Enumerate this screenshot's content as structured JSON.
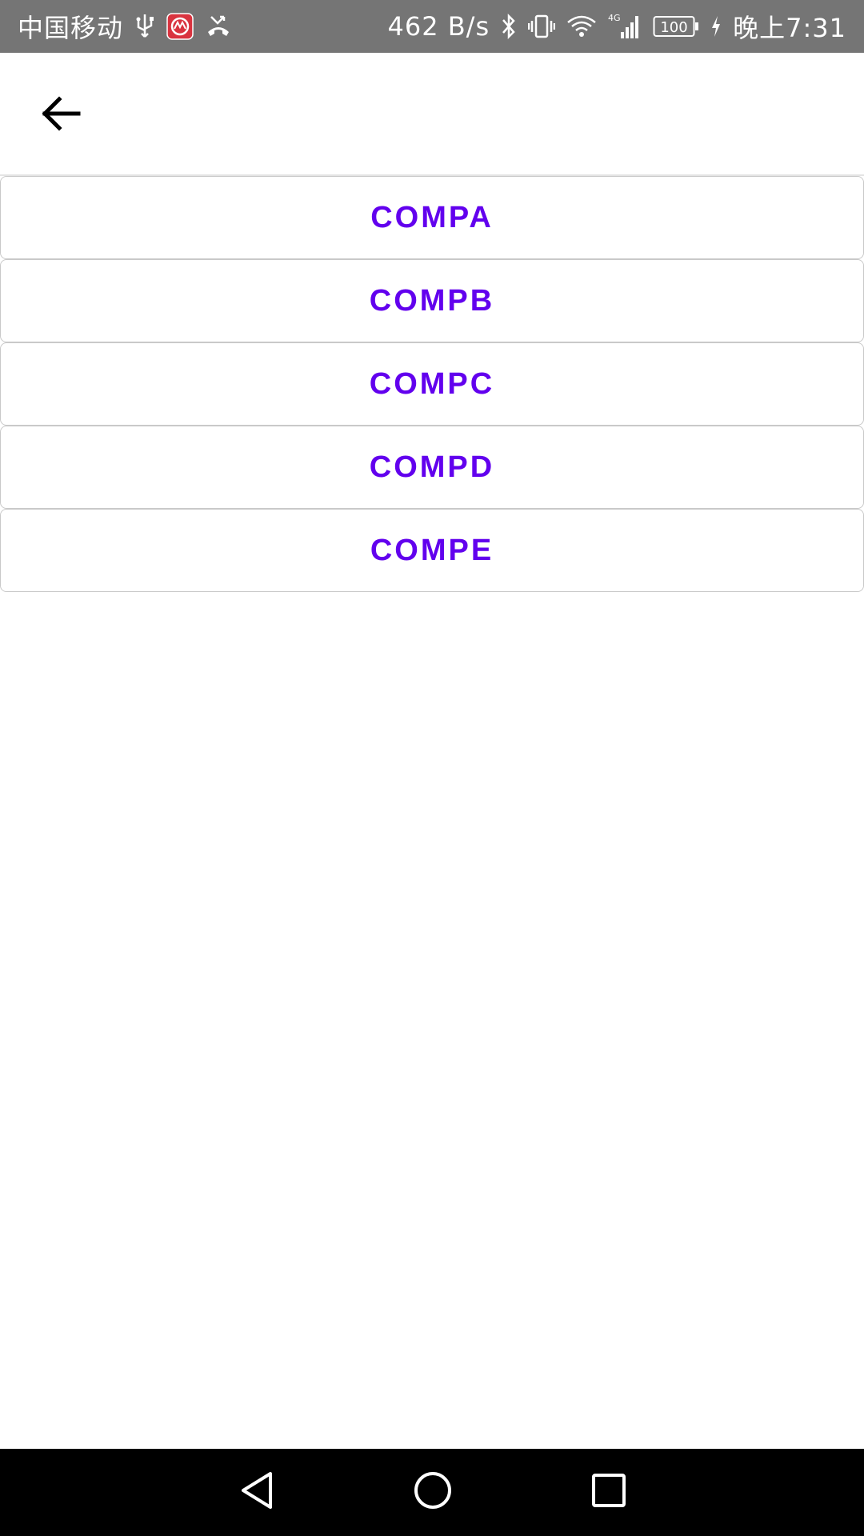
{
  "status_bar": {
    "carrier": "中国移动",
    "network_speed": "462 B/s",
    "battery": "100",
    "time": "晚上7:31",
    "icons": [
      "usb-icon",
      "bank-app-icon",
      "missed-call-icon",
      "bluetooth-icon",
      "vibrate-icon",
      "wifi-icon",
      "4g-icon",
      "signal-icon",
      "battery-icon",
      "charging-icon"
    ]
  },
  "toolbar": {
    "back_icon": "arrow-back-icon"
  },
  "buttons": [
    {
      "label": "COMPA"
    },
    {
      "label": "COMPB"
    },
    {
      "label": "COMPC"
    },
    {
      "label": "COMPD"
    },
    {
      "label": "COMPE"
    }
  ],
  "nav_bar": {
    "icons": [
      "back-triangle-icon",
      "home-circle-icon",
      "recents-square-icon"
    ]
  },
  "colors": {
    "accent": "#6200ee",
    "status_bar_bg": "#757575",
    "nav_bar_bg": "#000000"
  }
}
